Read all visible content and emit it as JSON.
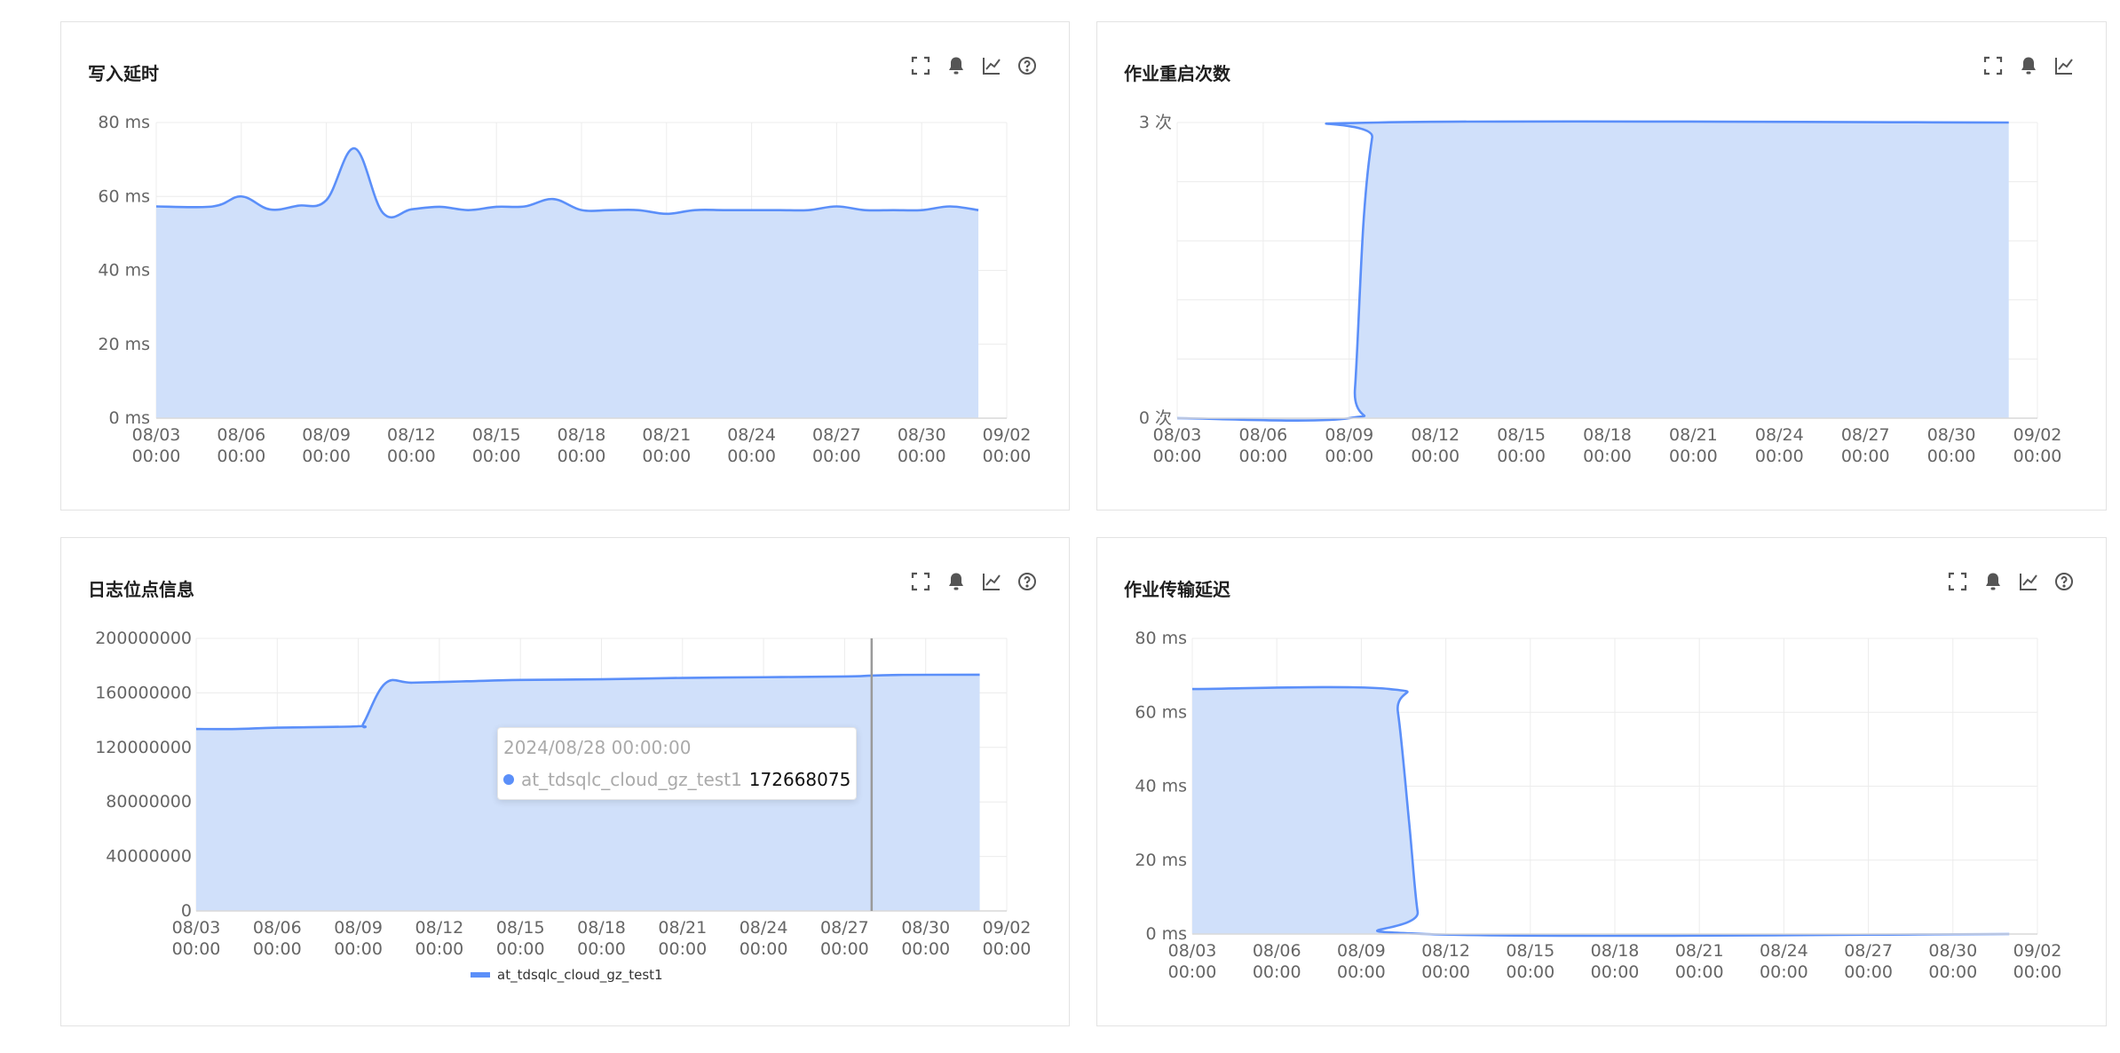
{
  "colors": {
    "line": "#5b8ff9",
    "area": "#d0e0fa",
    "grid": "#ececec",
    "axis": "#d9d9d9",
    "crosshair": "#9a9a9a"
  },
  "x_labels": [
    [
      "08/03",
      "00:00"
    ],
    [
      "08/06",
      "00:00"
    ],
    [
      "08/09",
      "00:00"
    ],
    [
      "08/12",
      "00:00"
    ],
    [
      "08/15",
      "00:00"
    ],
    [
      "08/18",
      "00:00"
    ],
    [
      "08/21",
      "00:00"
    ],
    [
      "08/24",
      "00:00"
    ],
    [
      "08/27",
      "00:00"
    ],
    [
      "08/30",
      "00:00"
    ],
    [
      "09/02",
      "00:00"
    ]
  ],
  "panels": [
    {
      "id": "write-latency",
      "title": "写入延时",
      "icons": [
        "fullscreen-icon",
        "bell-icon",
        "line-chart-icon",
        "help-icon"
      ],
      "chart_data": {
        "type": "area",
        "title": "写入延时",
        "xlabel": "",
        "ylabel": "",
        "x_range_days": [
          0,
          30
        ],
        "ylim": [
          0,
          80
        ],
        "y_ticks": [
          {
            "v": 0,
            "label": "0 ms"
          },
          {
            "v": 20,
            "label": "20 ms"
          },
          {
            "v": 40,
            "label": "40 ms"
          },
          {
            "v": 60,
            "label": "60 ms"
          },
          {
            "v": 80,
            "label": "80 ms"
          }
        ],
        "grid": true,
        "series": [
          {
            "name": "",
            "points": [
              [
                0,
                57.3
              ],
              [
                2,
                57.3
              ],
              [
                3,
                60
              ],
              [
                4,
                56.5
              ],
              [
                5,
                57.5
              ],
              [
                6,
                59
              ],
              [
                7,
                73
              ],
              [
                8,
                55.5
              ],
              [
                9,
                56.5
              ],
              [
                10,
                57.2
              ],
              [
                11,
                56.3
              ],
              [
                12,
                57.2
              ],
              [
                13,
                57.3
              ],
              [
                14,
                59.3
              ],
              [
                15,
                56.3
              ],
              [
                16,
                56.3
              ],
              [
                17,
                56.3
              ],
              [
                18,
                55.3
              ],
              [
                19,
                56.3
              ],
              [
                20,
                56.3
              ],
              [
                21,
                56.3
              ],
              [
                22,
                56.3
              ],
              [
                23,
                56.3
              ],
              [
                24,
                57.3
              ],
              [
                25,
                56.3
              ],
              [
                26,
                56.3
              ],
              [
                27,
                56.3
              ],
              [
                28,
                57.3
              ],
              [
                29,
                56.3
              ]
            ]
          }
        ]
      }
    },
    {
      "id": "job-restart-count",
      "title": "作业重启次数",
      "icons": [
        "fullscreen-icon",
        "bell-icon",
        "line-chart-icon"
      ],
      "chart_data": {
        "type": "area",
        "title": "作业重启次数",
        "xlabel": "",
        "ylabel": "",
        "x_range_days": [
          0,
          30
        ],
        "ylim": [
          0,
          3
        ],
        "y_ticks": [
          {
            "v": 0,
            "label": "0 次"
          },
          {
            "v": 3,
            "label": "3 次"
          }
        ],
        "grid": true,
        "series": [
          {
            "name": "",
            "points": [
              [
                0,
                0
              ],
              [
                6,
                0
              ],
              [
                6.2,
                0.3
              ],
              [
                6.5,
                2.0
              ],
              [
                6.8,
                2.85
              ],
              [
                7.0,
                3
              ],
              [
                29,
                3
              ]
            ]
          }
        ]
      }
    },
    {
      "id": "log-position-info",
      "title": "日志位点信息",
      "icons": [
        "fullscreen-icon",
        "bell-icon",
        "line-chart-icon",
        "help-icon"
      ],
      "chart_data": {
        "type": "area",
        "title": "日志位点信息",
        "xlabel": "",
        "ylabel": "",
        "x_range_days": [
          0,
          30
        ],
        "ylim": [
          0,
          200000000
        ],
        "y_ticks": [
          {
            "v": 0,
            "label": "0"
          },
          {
            "v": 40000000,
            "label": "40000000"
          },
          {
            "v": 80000000,
            "label": "80000000"
          },
          {
            "v": 120000000,
            "label": "120000000"
          },
          {
            "v": 160000000,
            "label": "160000000"
          },
          {
            "v": 200000000,
            "label": "200000000"
          }
        ],
        "grid": true,
        "series": [
          {
            "name": "at_tdsqlc_cloud_gz_test1",
            "points": [
              [
                0,
                133500000
              ],
              [
                1.5,
                133500000
              ],
              [
                3,
                134500000
              ],
              [
                6,
                135500000
              ],
              [
                6.2,
                138000000
              ],
              [
                7,
                167000000
              ],
              [
                8,
                167500000
              ],
              [
                10,
                168500000
              ],
              [
                12,
                169500000
              ],
              [
                15,
                170000000
              ],
              [
                18,
                171000000
              ],
              [
                21,
                171500000
              ],
              [
                24,
                172000000
              ],
              [
                25,
                172668075
              ],
              [
                26,
                173200000
              ],
              [
                29,
                173300000
              ]
            ]
          }
        ],
        "crosshair_x_day": 25,
        "tooltip": {
          "time": "2024/08/28 00:00:00",
          "series": "at_tdsqlc_cloud_gz_test1",
          "value": "172668075"
        },
        "legend": {
          "position": "bottom",
          "label": "at_tdsqlc_cloud_gz_test1"
        }
      }
    },
    {
      "id": "job-transfer-delay",
      "title": "作业传输延迟",
      "icons": [
        "fullscreen-icon",
        "bell-icon",
        "line-chart-icon",
        "help-icon"
      ],
      "chart_data": {
        "type": "area",
        "title": "作业传输延迟",
        "xlabel": "",
        "ylabel": "",
        "x_range_days": [
          0,
          30
        ],
        "ylim": [
          0,
          80
        ],
        "y_ticks": [
          {
            "v": 0,
            "label": "0 ms"
          },
          {
            "v": 20,
            "label": "20 ms"
          },
          {
            "v": 40,
            "label": "40 ms"
          },
          {
            "v": 60,
            "label": "60 ms"
          },
          {
            "v": 80,
            "label": "80 ms"
          }
        ],
        "grid": true,
        "series": [
          {
            "name": "",
            "points": [
              [
                0,
                66.3
              ],
              [
                7,
                66.3
              ],
              [
                7.3,
                60
              ],
              [
                7.7,
                30
              ],
              [
                8.0,
                6
              ],
              [
                8.3,
                0
              ],
              [
                29,
                0
              ]
            ]
          }
        ]
      }
    }
  ]
}
